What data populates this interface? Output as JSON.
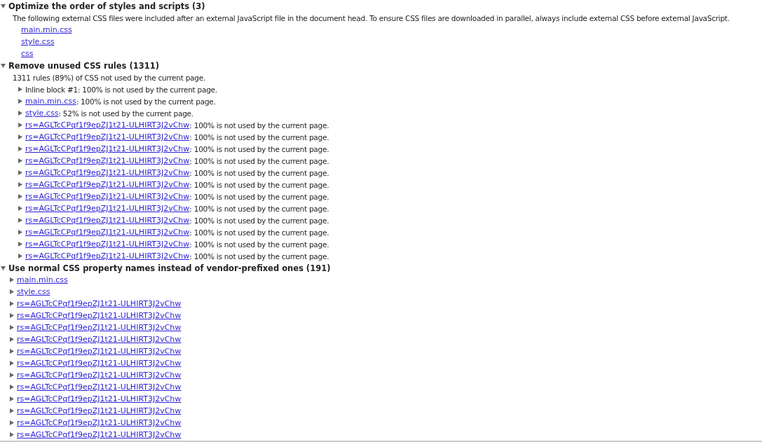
{
  "sections": [
    {
      "title": "Optimize the order of styles and scripts (3)",
      "expanded": true,
      "description": "The following external CSS files were included after an external JavaScript file in the document head. To ensure CSS files are downloaded in parallel, always include external CSS before external JavaScript.",
      "items": [
        {
          "kind": "file",
          "link": "main.min.css"
        },
        {
          "kind": "file",
          "link": "style.css"
        },
        {
          "kind": "file",
          "link": "css"
        }
      ]
    },
    {
      "title": "Remove unused CSS rules (1311)",
      "expanded": true,
      "description": "1311 rules (89%) of CSS not used by the current page.",
      "items": [
        {
          "kind": "result",
          "expanded": false,
          "text": "Inline block #1: 100% is not used by the current page."
        },
        {
          "kind": "result",
          "expanded": false,
          "link": "main.min.css",
          "text": ": 100% is not used by the current page."
        },
        {
          "kind": "result",
          "expanded": false,
          "link": "style.css",
          "text": ": 52% is not used by the current page."
        },
        {
          "kind": "result",
          "expanded": false,
          "link": "rs=AGLTcCPqf1f9epZJ1t21-ULHIRT3J2vChw",
          "text": ": 100% is not used by the current page."
        },
        {
          "kind": "result",
          "expanded": false,
          "link": "rs=AGLTcCPqf1f9epZJ1t21-ULHIRT3J2vChw",
          "text": ": 100% is not used by the current page."
        },
        {
          "kind": "result",
          "expanded": false,
          "link": "rs=AGLTcCPqf1f9epZJ1t21-ULHIRT3J2vChw",
          "text": ": 100% is not used by the current page."
        },
        {
          "kind": "result",
          "expanded": false,
          "link": "rs=AGLTcCPqf1f9epZJ1t21-ULHIRT3J2vChw",
          "text": ": 100% is not used by the current page."
        },
        {
          "kind": "result",
          "expanded": false,
          "link": "rs=AGLTcCPqf1f9epZJ1t21-ULHIRT3J2vChw",
          "text": ": 100% is not used by the current page."
        },
        {
          "kind": "result",
          "expanded": false,
          "link": "rs=AGLTcCPqf1f9epZJ1t21-ULHIRT3J2vChw",
          "text": ": 100% is not used by the current page."
        },
        {
          "kind": "result",
          "expanded": false,
          "link": "rs=AGLTcCPqf1f9epZJ1t21-ULHIRT3J2vChw",
          "text": ": 100% is not used by the current page."
        },
        {
          "kind": "result",
          "expanded": false,
          "link": "rs=AGLTcCPqf1f9epZJ1t21-ULHIRT3J2vChw",
          "text": ": 100% is not used by the current page."
        },
        {
          "kind": "result",
          "expanded": false,
          "link": "rs=AGLTcCPqf1f9epZJ1t21-ULHIRT3J2vChw",
          "text": ": 100% is not used by the current page."
        },
        {
          "kind": "result",
          "expanded": false,
          "link": "rs=AGLTcCPqf1f9epZJ1t21-ULHIRT3J2vChw",
          "text": ": 100% is not used by the current page."
        },
        {
          "kind": "result",
          "expanded": false,
          "link": "rs=AGLTcCPqf1f9epZJ1t21-ULHIRT3J2vChw",
          "text": ": 100% is not used by the current page."
        },
        {
          "kind": "result",
          "expanded": false,
          "link": "rs=AGLTcCPqf1f9epZJ1t21-ULHIRT3J2vChw",
          "text": ": 100% is not used by the current page."
        }
      ]
    },
    {
      "title": "Use normal CSS property names instead of vendor-prefixed ones (191)",
      "expanded": true,
      "items": [
        {
          "kind": "result",
          "expanded": false,
          "link": "main.min.css"
        },
        {
          "kind": "result",
          "expanded": false,
          "link": "style.css"
        },
        {
          "kind": "result",
          "expanded": false,
          "link": "rs=AGLTcCPqf1f9epZJ1t21-ULHIRT3J2vChw"
        },
        {
          "kind": "result",
          "expanded": false,
          "link": "rs=AGLTcCPqf1f9epZJ1t21-ULHIRT3J2vChw"
        },
        {
          "kind": "result",
          "expanded": false,
          "link": "rs=AGLTcCPqf1f9epZJ1t21-ULHIRT3J2vChw"
        },
        {
          "kind": "result",
          "expanded": false,
          "link": "rs=AGLTcCPqf1f9epZJ1t21-ULHIRT3J2vChw"
        },
        {
          "kind": "result",
          "expanded": false,
          "link": "rs=AGLTcCPqf1f9epZJ1t21-ULHIRT3J2vChw"
        },
        {
          "kind": "result",
          "expanded": false,
          "link": "rs=AGLTcCPqf1f9epZJ1t21-ULHIRT3J2vChw"
        },
        {
          "kind": "result",
          "expanded": false,
          "link": "rs=AGLTcCPqf1f9epZJ1t21-ULHIRT3J2vChw"
        },
        {
          "kind": "result",
          "expanded": false,
          "link": "rs=AGLTcCPqf1f9epZJ1t21-ULHIRT3J2vChw"
        },
        {
          "kind": "result",
          "expanded": false,
          "link": "rs=AGLTcCPqf1f9epZJ1t21-ULHIRT3J2vChw"
        },
        {
          "kind": "result",
          "expanded": false,
          "link": "rs=AGLTcCPqf1f9epZJ1t21-ULHIRT3J2vChw"
        },
        {
          "kind": "result",
          "expanded": false,
          "link": "rs=AGLTcCPqf1f9epZJ1t21-ULHIRT3J2vChw"
        },
        {
          "kind": "result",
          "expanded": false,
          "link": "rs=AGLTcCPqf1f9epZJ1t21-ULHIRT3J2vChw"
        }
      ]
    }
  ]
}
